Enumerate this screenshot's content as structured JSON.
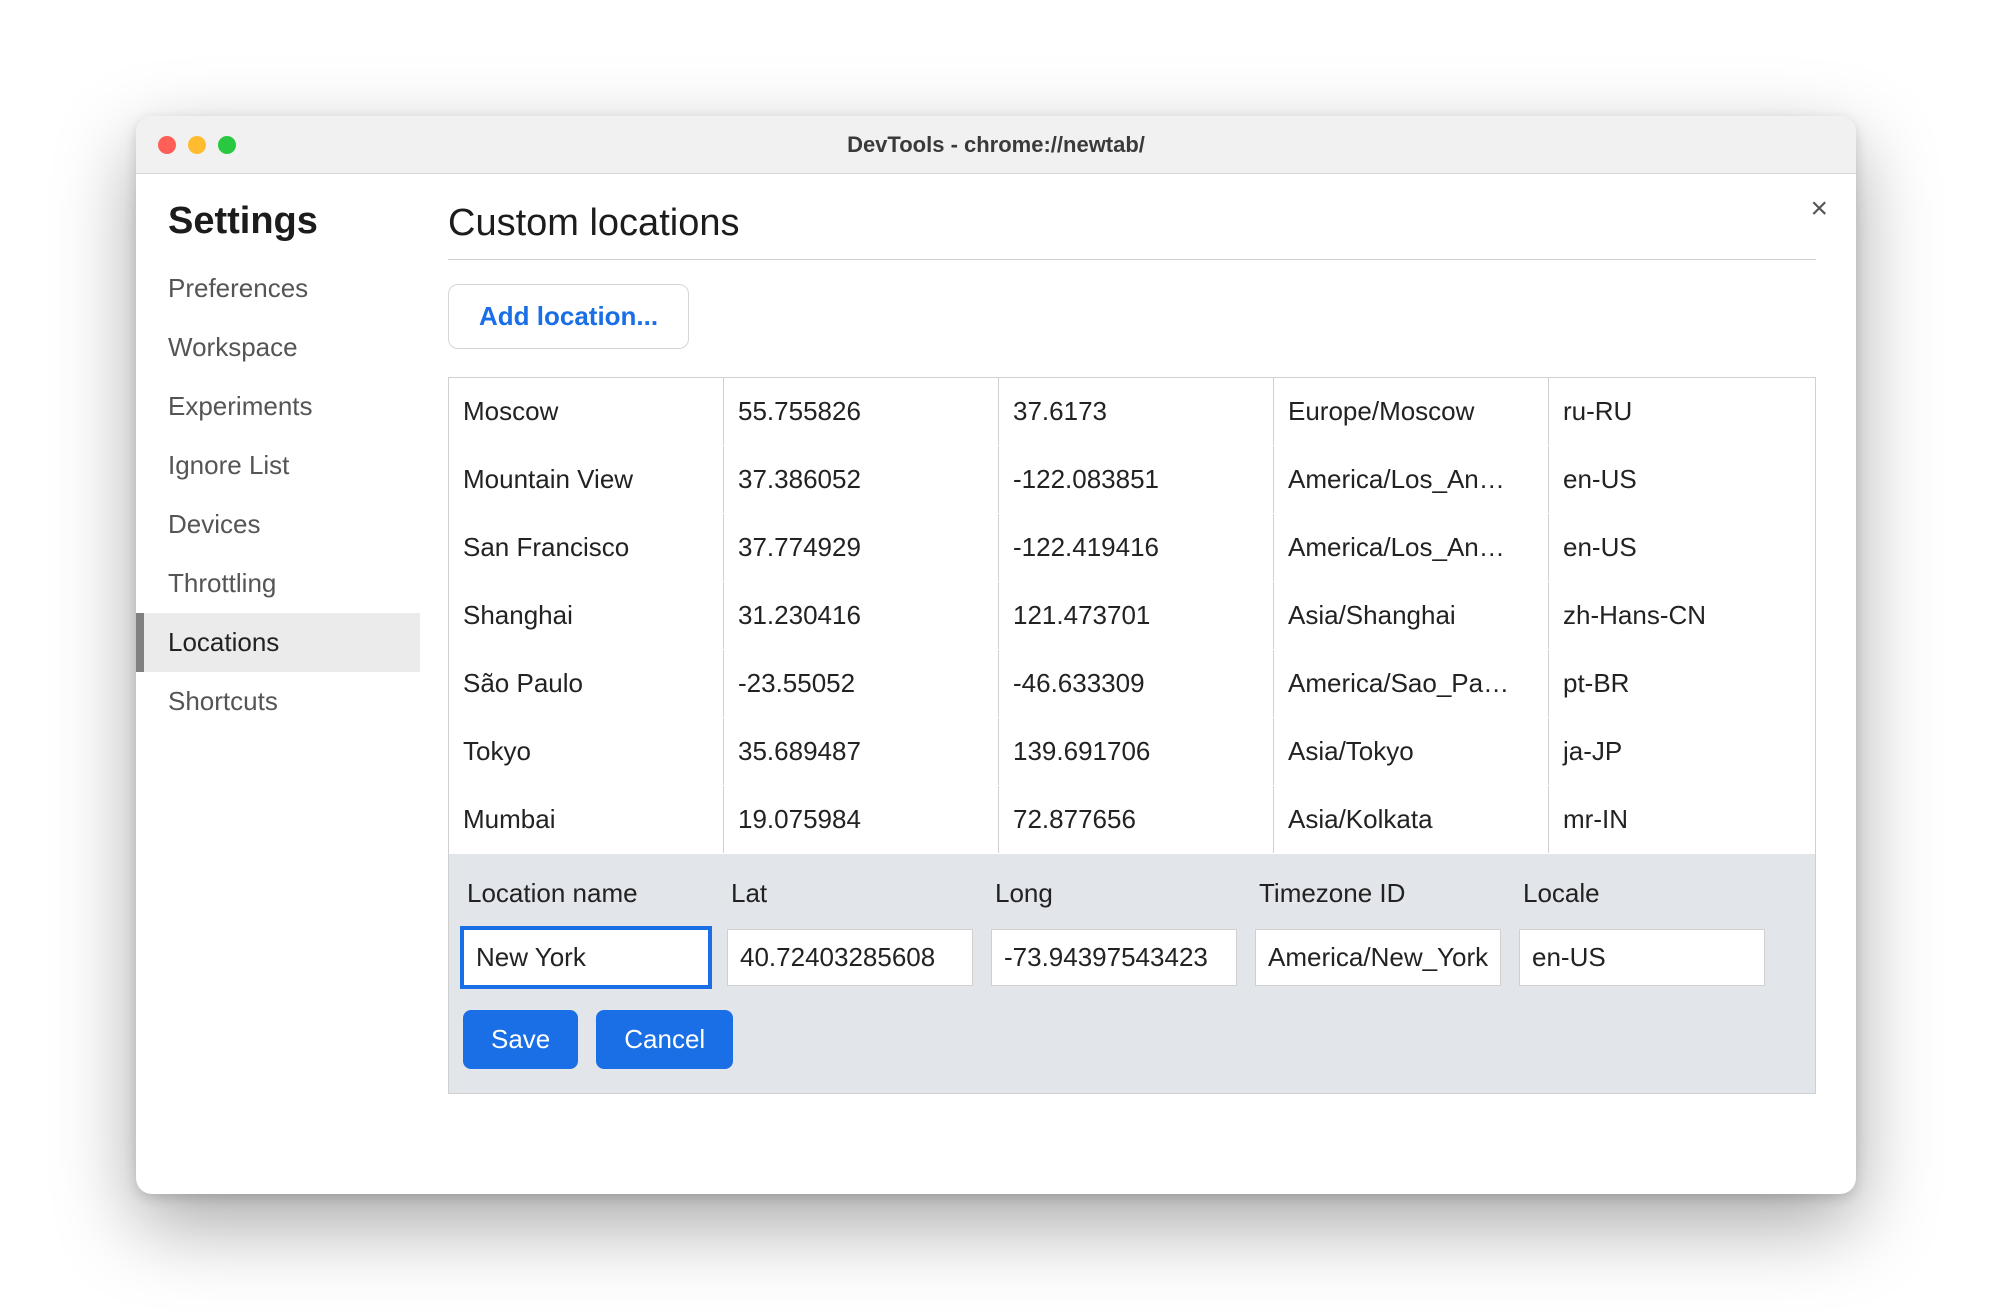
{
  "window_title": "DevTools - chrome://newtab/",
  "close_glyph": "×",
  "sidebar": {
    "heading": "Settings",
    "items": [
      {
        "label": "Preferences",
        "selected": false
      },
      {
        "label": "Workspace",
        "selected": false
      },
      {
        "label": "Experiments",
        "selected": false
      },
      {
        "label": "Ignore List",
        "selected": false
      },
      {
        "label": "Devices",
        "selected": false
      },
      {
        "label": "Throttling",
        "selected": false
      },
      {
        "label": "Locations",
        "selected": true
      },
      {
        "label": "Shortcuts",
        "selected": false
      }
    ]
  },
  "main": {
    "heading": "Custom locations",
    "add_button_label": "Add location...",
    "rows": [
      {
        "name": "Moscow",
        "lat": "55.755826",
        "long": "37.6173",
        "tz": "Europe/Moscow",
        "tz_display": "Europe/Moscow",
        "locale": "ru-RU"
      },
      {
        "name": "Mountain View",
        "lat": "37.386052",
        "long": "-122.083851",
        "tz": "America/Los_Angeles",
        "tz_display": "America/Los_An…",
        "locale": "en-US"
      },
      {
        "name": "San Francisco",
        "lat": "37.774929",
        "long": "-122.419416",
        "tz": "America/Los_Angeles",
        "tz_display": "America/Los_An…",
        "locale": "en-US"
      },
      {
        "name": "Shanghai",
        "lat": "31.230416",
        "long": "121.473701",
        "tz": "Asia/Shanghai",
        "tz_display": "Asia/Shanghai",
        "locale": "zh-Hans-CN"
      },
      {
        "name": "São Paulo",
        "lat": "-23.55052",
        "long": "-46.633309",
        "tz": "America/Sao_Paulo",
        "tz_display": "America/Sao_Pa…",
        "locale": "pt-BR"
      },
      {
        "name": "Tokyo",
        "lat": "35.689487",
        "long": "139.691706",
        "tz": "Asia/Tokyo",
        "tz_display": "Asia/Tokyo",
        "locale": "ja-JP"
      },
      {
        "name": "Mumbai",
        "lat": "19.075984",
        "long": "72.877656",
        "tz": "Asia/Kolkata",
        "tz_display": "Asia/Kolkata",
        "locale": "mr-IN"
      }
    ],
    "editor": {
      "headers": {
        "name": "Location name",
        "lat": "Lat",
        "long": "Long",
        "tz": "Timezone ID",
        "locale": "Locale"
      },
      "values": {
        "name": "New York",
        "lat": "40.72403285608",
        "long": "-73.94397543423",
        "tz": "America/New_York",
        "locale": "en-US"
      },
      "save_label": "Save",
      "cancel_label": "Cancel"
    }
  }
}
